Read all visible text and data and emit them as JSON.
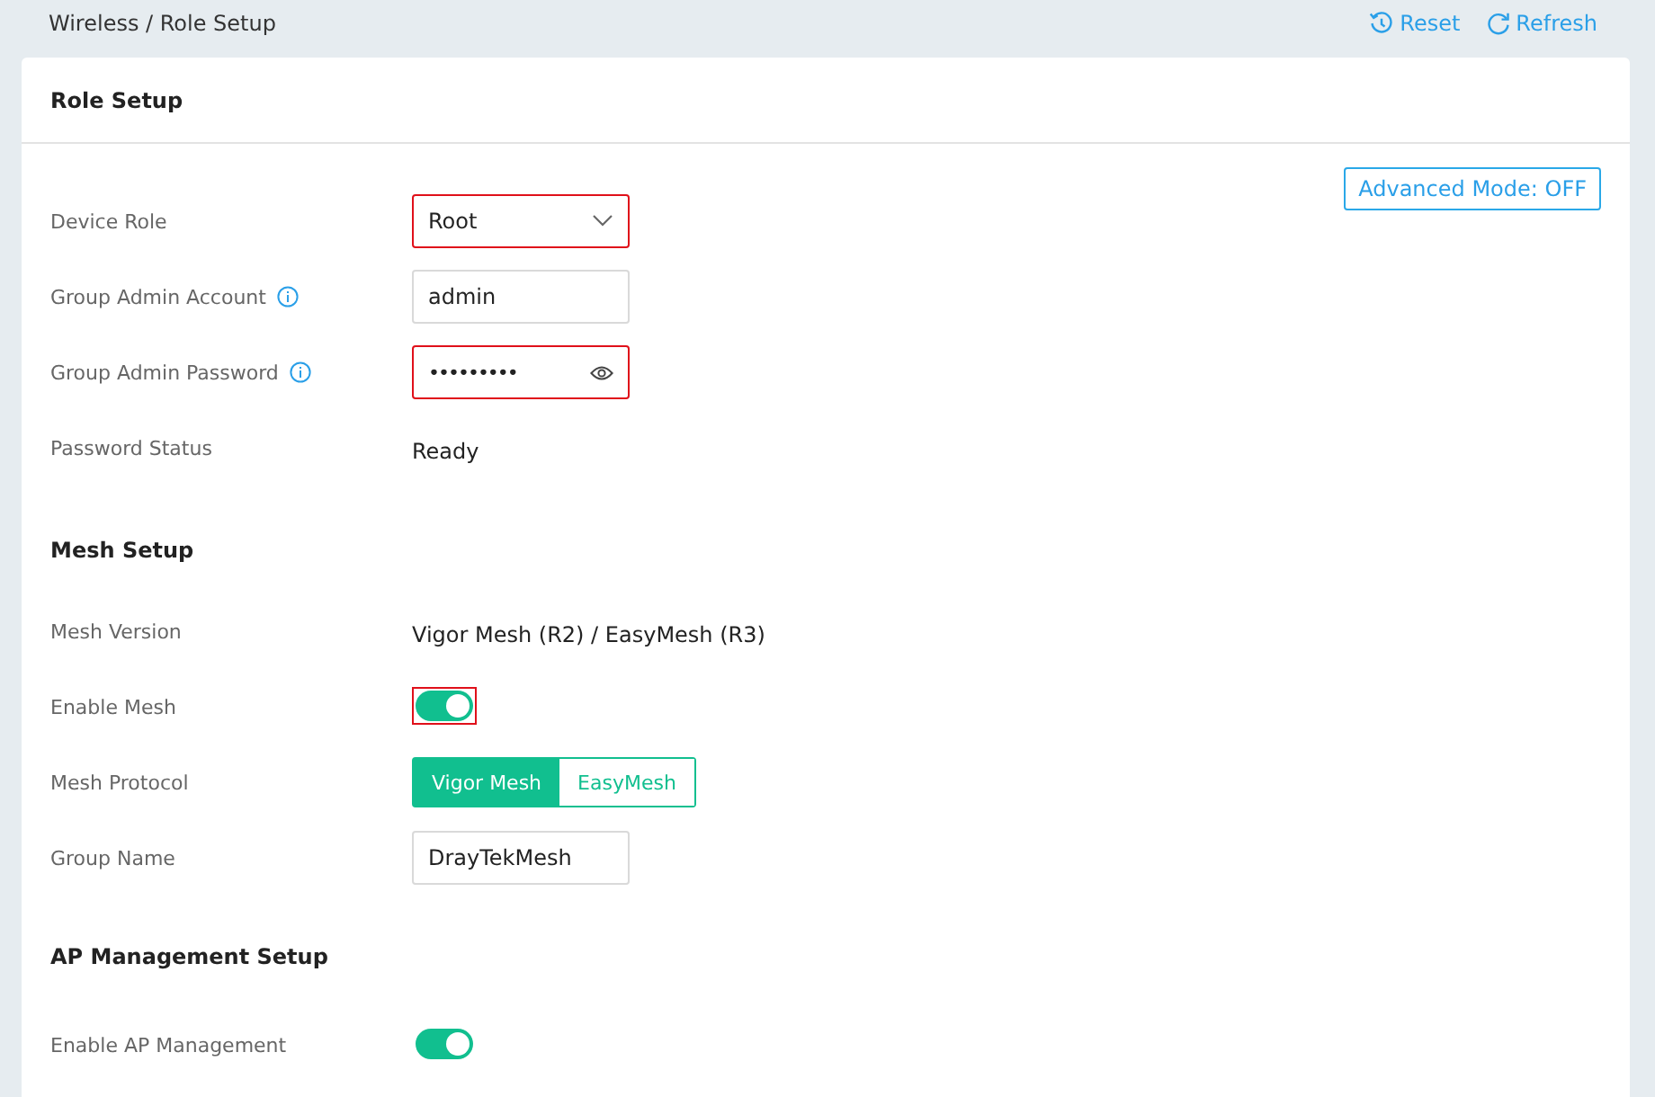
{
  "breadcrumb": "Wireless / Role Setup",
  "actions": [
    {
      "kind": "reset",
      "label": "Reset"
    },
    {
      "kind": "refresh",
      "label": "Refresh"
    }
  ],
  "card_title": "Role Setup",
  "advanced_mode_button": "Advanced Mode: OFF",
  "sections": [
    {
      "rows": [
        {
          "kind": "select",
          "label": "Device Role",
          "value": "Root",
          "highlighted": true,
          "info": false
        },
        {
          "kind": "input",
          "label": "Group Admin Account",
          "value": "admin",
          "highlighted": false,
          "info": true
        },
        {
          "kind": "password",
          "label": "Group Admin Password",
          "value": "•••••••••",
          "highlighted": true,
          "info": true
        },
        {
          "kind": "text",
          "label": "Password Status",
          "value": "Ready",
          "info": false
        }
      ]
    },
    {
      "title": "Mesh Setup",
      "rows": [
        {
          "kind": "text",
          "label": "Mesh Version",
          "value": "Vigor Mesh (R2) / EasyMesh (R3)",
          "info": false
        },
        {
          "kind": "toggle",
          "label": "Enable Mesh",
          "on": true,
          "highlighted": true,
          "info": false
        },
        {
          "kind": "segmented",
          "label": "Mesh Protocol",
          "info": false,
          "options": [
            {
              "label": "Vigor Mesh",
              "selected": true
            },
            {
              "label": "EasyMesh",
              "selected": false
            }
          ]
        },
        {
          "kind": "input",
          "label": "Group Name",
          "value": "DrayTekMesh",
          "highlighted": false,
          "info": false
        }
      ]
    },
    {
      "title": "AP Management Setup",
      "rows": [
        {
          "kind": "toggle",
          "label": "Enable AP Management",
          "on": true,
          "highlighted": false,
          "info": false
        }
      ]
    }
  ]
}
